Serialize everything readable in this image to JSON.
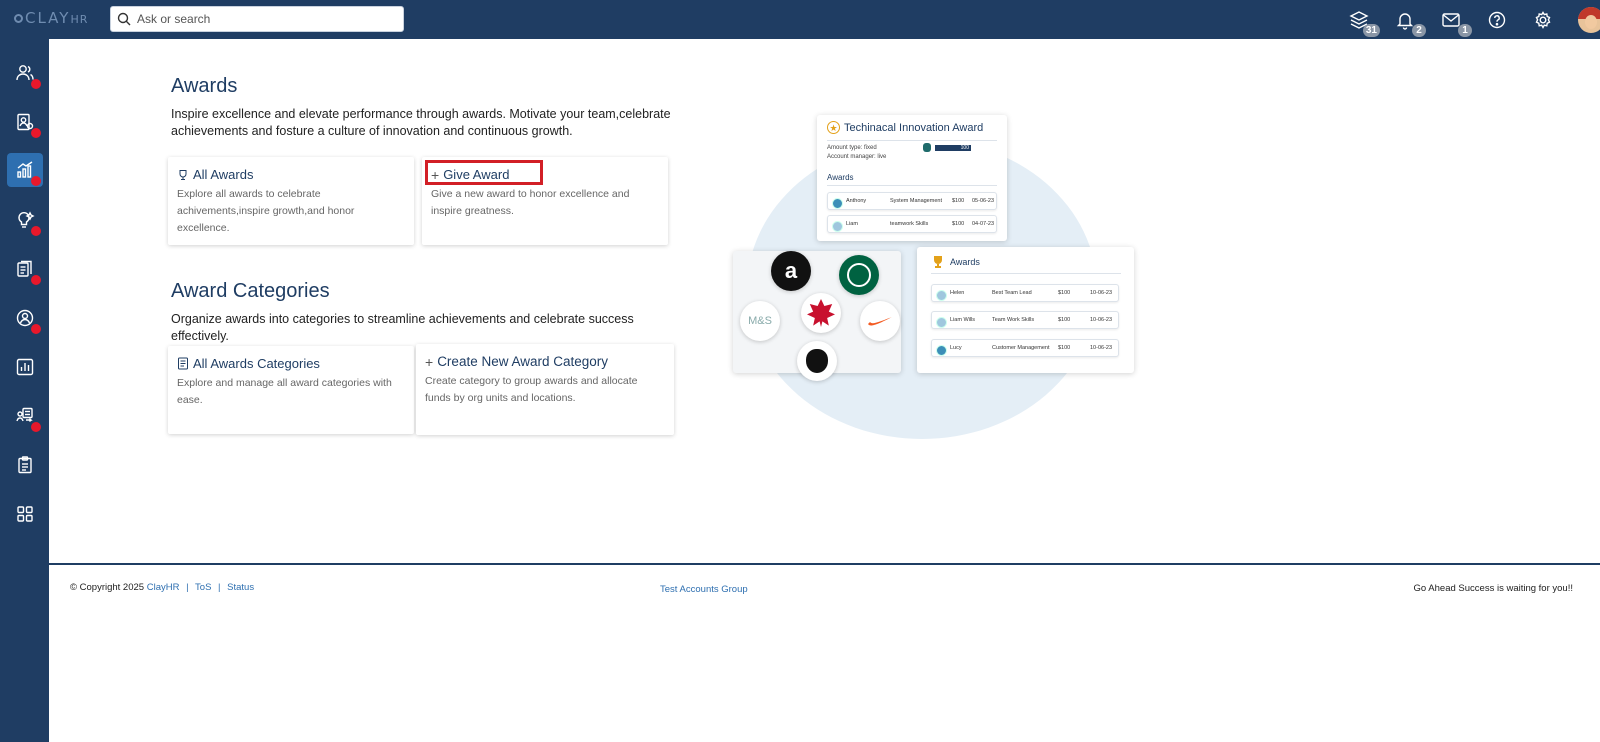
{
  "topbar": {
    "logo": "CLAY",
    "logo_suffix": "HR",
    "search_placeholder": "Ask or search",
    "icons": [
      {
        "name": "layers-icon",
        "badge": "31"
      },
      {
        "name": "bell-icon",
        "badge": "2"
      },
      {
        "name": "mail-icon",
        "badge": "1"
      },
      {
        "name": "help-icon",
        "badge": ""
      },
      {
        "name": "gear-icon",
        "badge": ""
      }
    ]
  },
  "sidebar": {
    "items": [
      {
        "name": "people-icon",
        "dot": true
      },
      {
        "name": "user-badge-icon",
        "dot": true
      },
      {
        "name": "chart-growth-icon",
        "dot": true,
        "active": true
      },
      {
        "name": "lightbulb-icon",
        "dot": true
      },
      {
        "name": "documents-icon",
        "dot": true
      },
      {
        "name": "person-circle-icon",
        "dot": true
      },
      {
        "name": "bar-chart-icon",
        "dot": false
      },
      {
        "name": "workflow-icon",
        "dot": true
      },
      {
        "name": "clipboard-icon",
        "dot": false
      },
      {
        "name": "apps-grid-icon",
        "dot": false
      }
    ]
  },
  "awards": {
    "title": "Awards",
    "description": "Inspire excellence and elevate performance through awards. Motivate your team,celebrate achievements and fosture a culture of innovation and continuous growth.",
    "cards": [
      {
        "icon": "trophy-outline-icon",
        "title": "All Awards",
        "desc": "Explore all awards to celebrate achivements,inspire growth,and honor excellence."
      },
      {
        "icon": "plus-icon",
        "title": "Give Award",
        "desc": "Give a new award to honor excellence and inspire greatness."
      }
    ]
  },
  "categories": {
    "title": "Award Categories",
    "description": "Organize awards into categories to streamline achievements and celebrate success effectively.",
    "cards": [
      {
        "icon": "category-book-icon",
        "title": "All Awards Categories",
        "desc": "Explore and manage all award categories with ease."
      },
      {
        "icon": "plus-icon",
        "title": "Create New Award Category",
        "desc": "Create category to group awards and allocate funds by org units and locations."
      }
    ]
  },
  "illustration": {
    "top_panel": {
      "title": "Techinacal Innovation Award",
      "field1": "Amount type: fixed",
      "field2": "Account manager: live",
      "value": "100",
      "section": "Awards",
      "rows": [
        {
          "name": "Anthony",
          "category": "System Management",
          "amount": "$100",
          "date": "05-06-23"
        },
        {
          "name": "Liam",
          "category": "teamwork Skills",
          "amount": "$100",
          "date": "04-07-23"
        }
      ]
    },
    "logos": [
      {
        "name": "amazon-logo",
        "text": "a"
      },
      {
        "name": "starbucks-logo",
        "text": ""
      },
      {
        "name": "ms-logo",
        "text": "M&S"
      },
      {
        "name": "tim-hortons-logo",
        "text": "Tim Hortons"
      },
      {
        "name": "nike-logo",
        "text": ""
      },
      {
        "name": "apple-logo",
        "text": ""
      }
    ],
    "right_panel": {
      "title": "Awards",
      "rows": [
        {
          "name": "Helen",
          "category": "Best Team Lead",
          "amount": "$100",
          "date": "10-06-23"
        },
        {
          "name": "Liam Wills",
          "category": "Team Work Skills",
          "amount": "$100",
          "date": "10-06-23"
        },
        {
          "name": "Lucy",
          "category": "Customer Management",
          "amount": "$100",
          "date": "10-06-23"
        }
      ]
    }
  },
  "footer": {
    "copyright": "© Copyright 2025",
    "brand_link": "ClayHR",
    "tos": "ToS",
    "status": "Status",
    "separator": "|",
    "center": "Test Accounts Group",
    "right": "Go Ahead Success is waiting for you!!"
  },
  "colors": {
    "nav": "#1f3d63",
    "accent": "#2e6fb0",
    "dot": "#e8182b",
    "highlight": "#d21f26"
  }
}
